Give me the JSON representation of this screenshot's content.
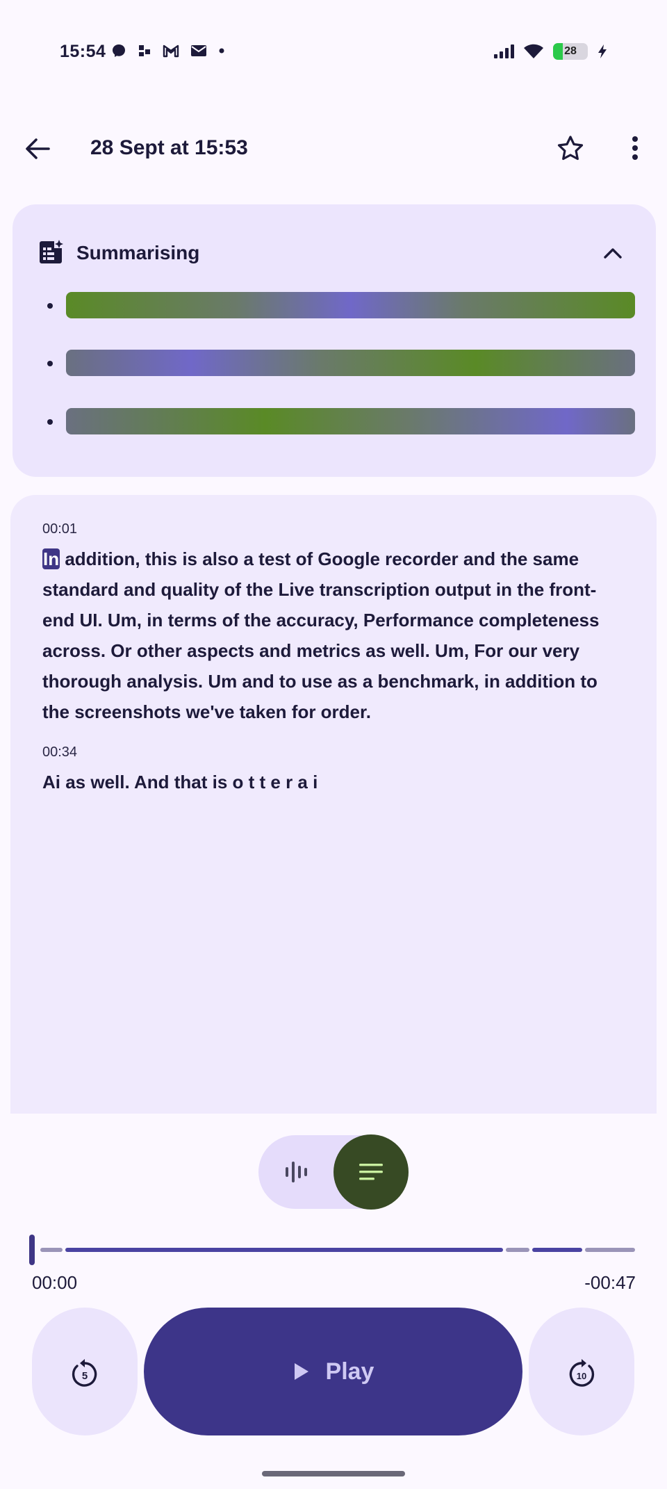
{
  "status_bar": {
    "time": "15:54",
    "battery_level": "28",
    "left_icons": [
      "messenger-icon",
      "grid-icon",
      "gmail-icon",
      "mail-icon",
      "dot-icon"
    ],
    "right_icons": [
      "signal-icon",
      "wifi-icon",
      "battery-icon",
      "charging-icon"
    ]
  },
  "app_bar": {
    "title": "28 Sept at 15:53"
  },
  "summary": {
    "title": "Summarising",
    "expanded": true
  },
  "transcript": {
    "blocks": [
      {
        "timestamp": "00:01",
        "highlighted_word": "In",
        "text": " addition, this is also a test of Google recorder and the same standard and quality of the Live transcription output in the front-end UI. Um, in terms of the accuracy, Performance completeness across. Or other aspects and metrics as well. Um, For our very thorough analysis. Um and to use as a benchmark, in addition to the screenshots we've taken for order."
      },
      {
        "timestamp": "00:34",
        "text": "Ai as well. And that is o t t e r a i"
      }
    ]
  },
  "view_toggle": {
    "selected": "transcript"
  },
  "player": {
    "elapsed": "00:00",
    "remaining": "-00:47",
    "progress": 0.0,
    "play_label": "Play",
    "rewind_seconds": "5",
    "forward_seconds": "10"
  },
  "colors": {
    "primary": "#3d3589",
    "surface": "#fcf8ff",
    "card": "#ece5fd",
    "toggle_selected": "#374a24"
  }
}
